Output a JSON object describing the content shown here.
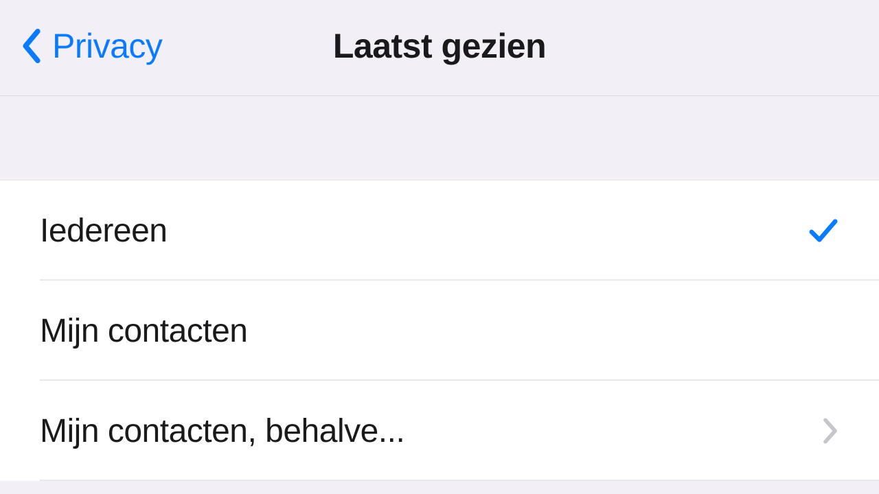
{
  "header": {
    "back_label": "Privacy",
    "title": "Laatst gezien"
  },
  "options": [
    {
      "label": "Iedereen",
      "selected": true,
      "disclosure": false
    },
    {
      "label": "Mijn contacten",
      "selected": false,
      "disclosure": false
    },
    {
      "label": "Mijn contacten, behalve...",
      "selected": false,
      "disclosure": true
    }
  ],
  "colors": {
    "accent": "#0a7bff",
    "background": "#f2f0f6",
    "row_background": "#ffffff",
    "separator": "#e8e8ec",
    "text": "#1a1a1c",
    "chevron": "#c5c5ca"
  }
}
